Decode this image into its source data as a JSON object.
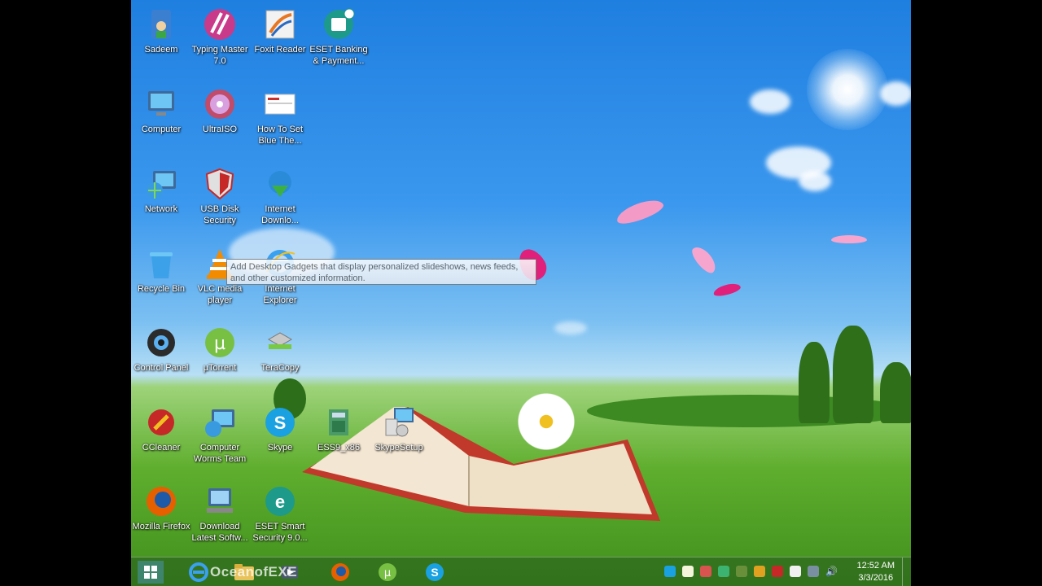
{
  "desktop": {
    "icons": [
      {
        "label": "Sadeem",
        "icon": "user-folder-icon"
      },
      {
        "label": "Typing Master 7.0",
        "icon": "typing-master-icon"
      },
      {
        "label": "Foxit Reader",
        "icon": "foxit-reader-icon"
      },
      {
        "label": "ESET Banking & Payment...",
        "icon": "eset-banking-icon"
      },
      {
        "label": "Computer",
        "icon": "computer-icon"
      },
      {
        "label": "UltraISO",
        "icon": "ultraiso-icon"
      },
      {
        "label": "How To Set Blue The...",
        "icon": "document-shortcut-icon"
      },
      {
        "label": "Network",
        "icon": "network-icon"
      },
      {
        "label": "USB Disk Security",
        "icon": "usb-disk-security-icon"
      },
      {
        "label": "Internet Downlo...",
        "icon": "internet-download-manager-icon"
      },
      {
        "label": "Recycle Bin",
        "icon": "recycle-bin-icon"
      },
      {
        "label": "VLC media player",
        "icon": "vlc-icon"
      },
      {
        "label": "Internet Explorer",
        "icon": "internet-explorer-icon"
      },
      {
        "label": "Control Panel",
        "icon": "control-panel-icon"
      },
      {
        "label": "µTorrent",
        "icon": "utorrent-icon"
      },
      {
        "label": "TeraCopy",
        "icon": "teracopy-icon"
      },
      {
        "label": "CCleaner",
        "icon": "ccleaner-icon"
      },
      {
        "label": "Computer Worms Team",
        "icon": "computer-worms-icon"
      },
      {
        "label": "Skype",
        "icon": "skype-icon"
      },
      {
        "label": "ESS9_x86",
        "icon": "ess-installer-icon"
      },
      {
        "label": "SkypeSetup",
        "icon": "skype-setup-icon"
      },
      {
        "label": "Mozilla Firefox",
        "icon": "firefox-icon"
      },
      {
        "label": "Download Latest Softw...",
        "icon": "download-software-icon"
      },
      {
        "label": "ESET Smart Security 9.0...",
        "icon": "eset-smart-security-icon"
      }
    ],
    "tooltip": "Add Desktop Gadgets that display personalized slideshows, news feeds, and other customized information."
  },
  "taskbar": {
    "watermark": "OceanofEXE",
    "pinned": [
      "internet-explorer-icon",
      "file-explorer-icon",
      "media-icon",
      "firefox-icon",
      "utorrent-icon",
      "skype-icon"
    ],
    "clock": {
      "time": "12:52 AM",
      "date": "3/3/2016"
    }
  }
}
